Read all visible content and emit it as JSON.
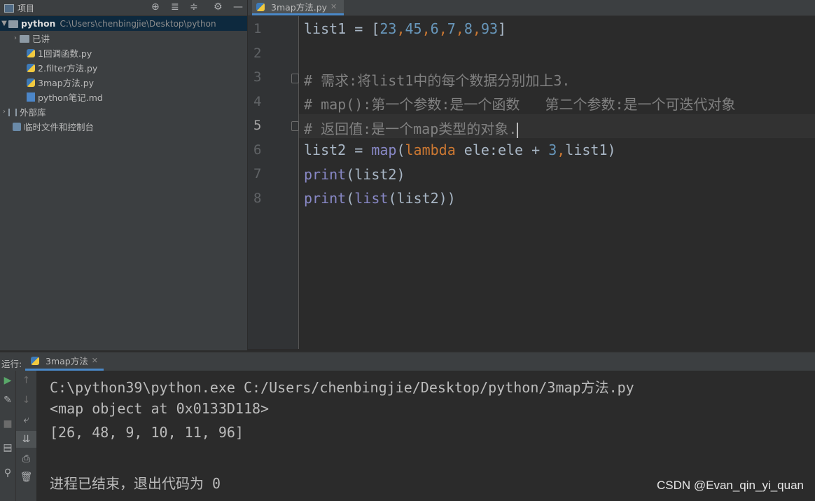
{
  "project_panel": {
    "title": "项目",
    "root": {
      "name": "python",
      "path": "C:\\Users\\chenbingjie\\Desktop\\python"
    },
    "items": [
      {
        "label": "已讲",
        "type": "folder"
      },
      {
        "label": "1回调函数.py",
        "type": "py"
      },
      {
        "label": "2.filter方法.py",
        "type": "py"
      },
      {
        "label": "3map方法.py",
        "type": "py"
      },
      {
        "label": "python笔记.md",
        "type": "md"
      }
    ],
    "external_libs": "外部库",
    "scratches": "临时文件和控制台"
  },
  "editor": {
    "tab_label": "3map方法.py",
    "line_numbers": [
      "1",
      "2",
      "3",
      "4",
      "5",
      "6",
      "7",
      "8"
    ],
    "current_line": 5,
    "lines": {
      "l1_var": "list1 = [",
      "l1_nums": [
        "23",
        "45",
        "6",
        "7",
        "8",
        "93"
      ],
      "l3": "# 需求:将list1中的每个数据分别加上3.",
      "l4": "# map():第一个参数:是一个函数   第二个参数:是一个可迭代对象",
      "l5": "# 返回值:是一个map类型的对象.",
      "l6_a": "list2 = ",
      "l6_map": "map",
      "l6_lambda": "lambda",
      "l6_b": " ele:ele + ",
      "l6_num": "3",
      "l6_c": "list1)",
      "l7_print": "print",
      "l7_rest": "(list2)",
      "l8_print": "print",
      "l8_list": "list",
      "l8_rest": "(list2))"
    }
  },
  "run_panel": {
    "label": "运行:",
    "tab_label": "3map方法",
    "output": [
      "C:\\python39\\python.exe C:/Users/chenbingjie/Desktop/python/3map方法.py",
      "<map object at 0x0133D118>",
      "[26, 48, 9, 10, 11, 96]",
      "",
      "进程已结束，退出代码为 0"
    ]
  },
  "watermark": "CSDN @Evan_qin_yi_quan"
}
